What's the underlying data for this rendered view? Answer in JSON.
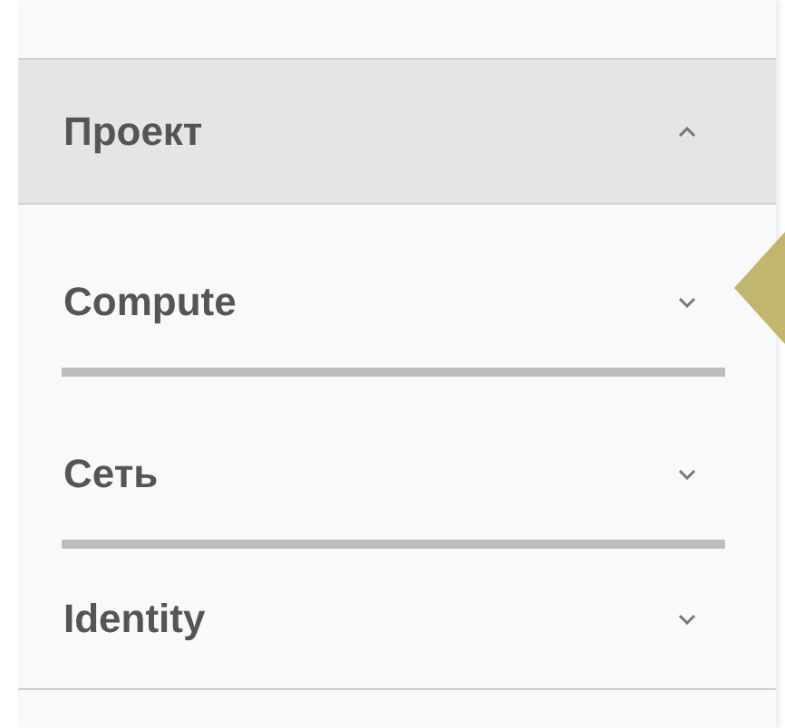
{
  "sidebar": {
    "items": [
      {
        "label": "Проект",
        "expanded": true,
        "children": [
          {
            "label": "Compute",
            "expanded": false
          },
          {
            "label": "Сеть",
            "expanded": false
          }
        ]
      },
      {
        "label": "Identity",
        "expanded": false
      }
    ]
  }
}
